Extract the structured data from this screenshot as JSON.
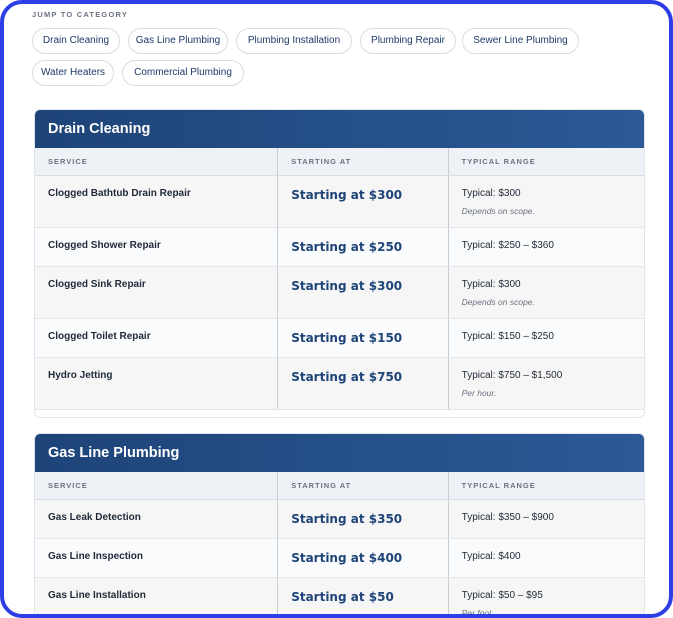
{
  "jump": {
    "label": "JUMP TO CATEGORY",
    "chips": [
      "Drain Cleaning",
      "Gas Line Plumbing",
      "Plumbing Installation",
      "Plumbing Repair",
      "Sewer Line Plumbing",
      "Water Heaters",
      "Commercial Plumbing"
    ]
  },
  "columns": {
    "service": "SERVICE",
    "starting": "STARTING AT",
    "range": "TYPICAL RANGE"
  },
  "categories": [
    {
      "title": "Drain Cleaning",
      "rows": [
        {
          "service": "Clogged Bathtub Drain Repair",
          "price": "Starting at $300",
          "range": "Typical: $300",
          "note": "Depends on scope."
        },
        {
          "service": "Clogged Shower Repair",
          "price": "Starting at $250",
          "range": "Typical: $250 – $360",
          "note": ""
        },
        {
          "service": "Clogged Sink Repair",
          "price": "Starting at $300",
          "range": "Typical: $300",
          "note": "Depends on scope."
        },
        {
          "service": "Clogged Toilet Repair",
          "price": "Starting at $150",
          "range": "Typical: $150 – $250",
          "note": ""
        },
        {
          "service": "Hydro Jetting",
          "price": "Starting at $750",
          "range": "Typical: $750 – $1,500",
          "note": "Per hour."
        }
      ]
    },
    {
      "title": "Gas Line Plumbing",
      "rows": [
        {
          "service": "Gas Leak Detection",
          "price": "Starting at $350",
          "range": "Typical: $350 – $900",
          "note": ""
        },
        {
          "service": "Gas Line Inspection",
          "price": "Starting at $400",
          "range": "Typical: $400",
          "note": ""
        },
        {
          "service": "Gas Line Installation",
          "price": "Starting at $50",
          "range": "Typical: $50 – $95",
          "note": "Per foot."
        }
      ]
    }
  ]
}
